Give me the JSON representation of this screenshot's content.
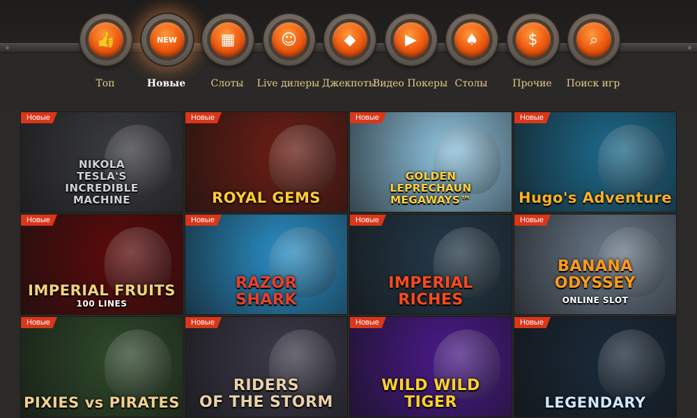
{
  "nav": {
    "items": [
      {
        "label": "Топ",
        "icon": "thumbs-up-icon",
        "glyph": "👍"
      },
      {
        "label": "Новые",
        "icon": "new-badge-icon",
        "glyph": "NEW"
      },
      {
        "label": "Слоты",
        "icon": "slot-machine-icon",
        "glyph": "▦"
      },
      {
        "label": "Live дилеры",
        "icon": "dealer-icon",
        "glyph": "☺"
      },
      {
        "label": "Джекпоты",
        "icon": "diamond-icon",
        "glyph": "◆"
      },
      {
        "label": "Видео Покеры",
        "icon": "video-icon",
        "glyph": "▶"
      },
      {
        "label": "Столы",
        "icon": "cards-icon",
        "glyph": "♠"
      },
      {
        "label": "Прочие",
        "icon": "money-bag-icon",
        "glyph": "$"
      },
      {
        "label": "Поиск игр",
        "icon": "search-icon",
        "glyph": "⌕"
      }
    ],
    "active_index": 1
  },
  "badge_label": "Новые",
  "games": [
    {
      "title": "NIKOLA TESLA'S INCREDIBLE MACHINE",
      "title_lines": [
        "NIKOLA",
        "TESLA'S",
        "INCREDIBLE",
        "MACHINE"
      ],
      "bg": "#3b3c40",
      "accent": "#cfd3d6"
    },
    {
      "title": "ROYAL GEMS",
      "bg": "#6a1e14",
      "accent": "#ffcc33"
    },
    {
      "title": "GOLDEN LEPRECHAUN MEGAWAYS™",
      "title_lines": [
        "GOLDEN",
        "LEPRECHAUN",
        "MEGAWAYS™"
      ],
      "bg": "#8fc4e0",
      "accent": "#ffd23a"
    },
    {
      "title": "Hugo's Adventure",
      "bg": "#1d6a8c",
      "accent": "#ffb020"
    },
    {
      "title": "IMPERIAL FRUITS",
      "subtitle": "100 LINES",
      "bg": "#5c0a0a",
      "accent": "#f2d27a"
    },
    {
      "title": "RAZOR SHARK",
      "title_lines": [
        "RAZOR",
        "SHARK"
      ],
      "bg": "#2a8fc7",
      "accent": "#e8402a"
    },
    {
      "title": "IMPERIAL RICHES",
      "title_lines": [
        "IMPERIAL",
        "RICHES"
      ],
      "bg": "#243a4a",
      "accent": "#ff4a1c"
    },
    {
      "title": "BANANA ODYSSEY",
      "subtitle": "ONLINE SLOT",
      "title_lines": [
        "BANANA",
        "ODYSSEY"
      ],
      "bg": "#6a7a8a",
      "accent": "#ff9a1a"
    },
    {
      "title": "PIXIES vs PIRATES",
      "bg": "#2f4a2a",
      "accent": "#f0d090"
    },
    {
      "title": "RIDERS OF THE STORM",
      "title_lines": [
        "RIDERS",
        "OF THE STORM"
      ],
      "bg": "#3d3a4a",
      "accent": "#e8d2a8"
    },
    {
      "title": "WILD WILD TIGER",
      "title_lines": [
        "WILD WILD",
        "TIGER"
      ],
      "bg": "#4a1a8a",
      "accent": "#ffd02a"
    },
    {
      "title": "LEGENDARY",
      "bg": "#1a2a3a",
      "accent": "#cfe6ff"
    }
  ]
}
